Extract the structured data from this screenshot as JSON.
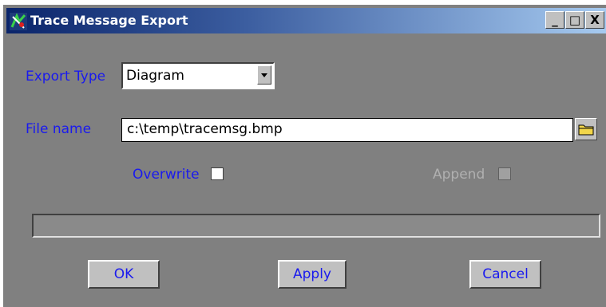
{
  "window": {
    "title": "Trace Message Export"
  },
  "titlebar_buttons": {
    "minimize": "_",
    "maximize": "□",
    "close": "X"
  },
  "export_type": {
    "label": "Export Type",
    "value": "Diagram"
  },
  "file_name": {
    "label": "File name",
    "value": "c:\\temp\\tracemsg.bmp"
  },
  "options": {
    "overwrite_label": "Overwrite",
    "append_label": "Append"
  },
  "progress": {
    "value": 0
  },
  "buttons": {
    "ok": "OK",
    "apply": "Apply",
    "cancel": "Cancel"
  },
  "colors": {
    "label_blue": "#1a1aee",
    "dialog_gray": "#808080",
    "title_dark": "#0a246a"
  }
}
